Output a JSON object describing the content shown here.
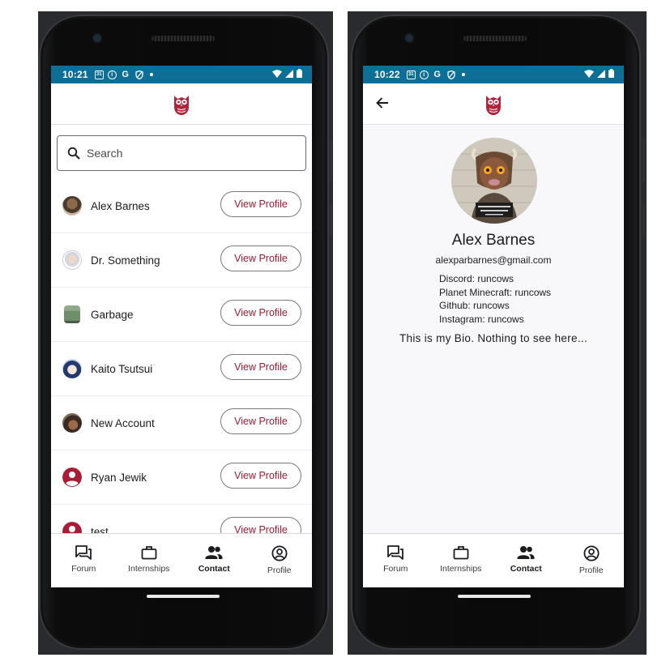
{
  "colors": {
    "status_bar": "#0e6e95",
    "accent": "#9e1b32",
    "screen_bg": "#ffffff"
  },
  "left_screen": {
    "status": {
      "time": "10:21",
      "icons": [
        "calendar-icon",
        "info-icon",
        "google-icon",
        "shield-icon",
        "dot-icon",
        "wifi-icon",
        "signal-icon",
        "battery-icon"
      ]
    },
    "search": {
      "placeholder": "Search"
    },
    "contacts": [
      {
        "name": "Alex Barnes",
        "button": "View Profile",
        "avatar": "photo"
      },
      {
        "name": "Dr. Something",
        "button": "View Profile",
        "avatar": "photo"
      },
      {
        "name": "Garbage",
        "button": "View Profile",
        "avatar": "photo"
      },
      {
        "name": "Kaito Tsutsui",
        "button": "View Profile",
        "avatar": "photo"
      },
      {
        "name": "New Account",
        "button": "View Profile",
        "avatar": "photo"
      },
      {
        "name": "Ryan Jewik",
        "button": "View Profile",
        "avatar": "account-circle-icon"
      },
      {
        "name": "test",
        "button": "View Profile",
        "avatar": "account-circle-icon"
      }
    ],
    "nav": [
      {
        "label": "Forum",
        "icon": "forum-icon"
      },
      {
        "label": "Internships",
        "icon": "briefcase-icon"
      },
      {
        "label": "Contact",
        "icon": "people-icon",
        "active": true
      },
      {
        "label": "Profile",
        "icon": "account-circle-icon"
      }
    ]
  },
  "right_screen": {
    "status": {
      "time": "10:22"
    },
    "profile": {
      "name": "Alex Barnes",
      "email": "alexparbarnes@gmail.com",
      "links": [
        "Discord: runcows",
        "Planet Minecraft: runcows",
        "Github: runcows",
        "Instagram: runcows"
      ],
      "bio": "This is my Bio. Nothing to see here..."
    },
    "nav": [
      {
        "label": "Forum",
        "icon": "forum-icon"
      },
      {
        "label": "Internships",
        "icon": "briefcase-icon"
      },
      {
        "label": "Contact",
        "icon": "people-icon",
        "active": true
      },
      {
        "label": "Profile",
        "icon": "account-circle-icon"
      }
    ]
  }
}
